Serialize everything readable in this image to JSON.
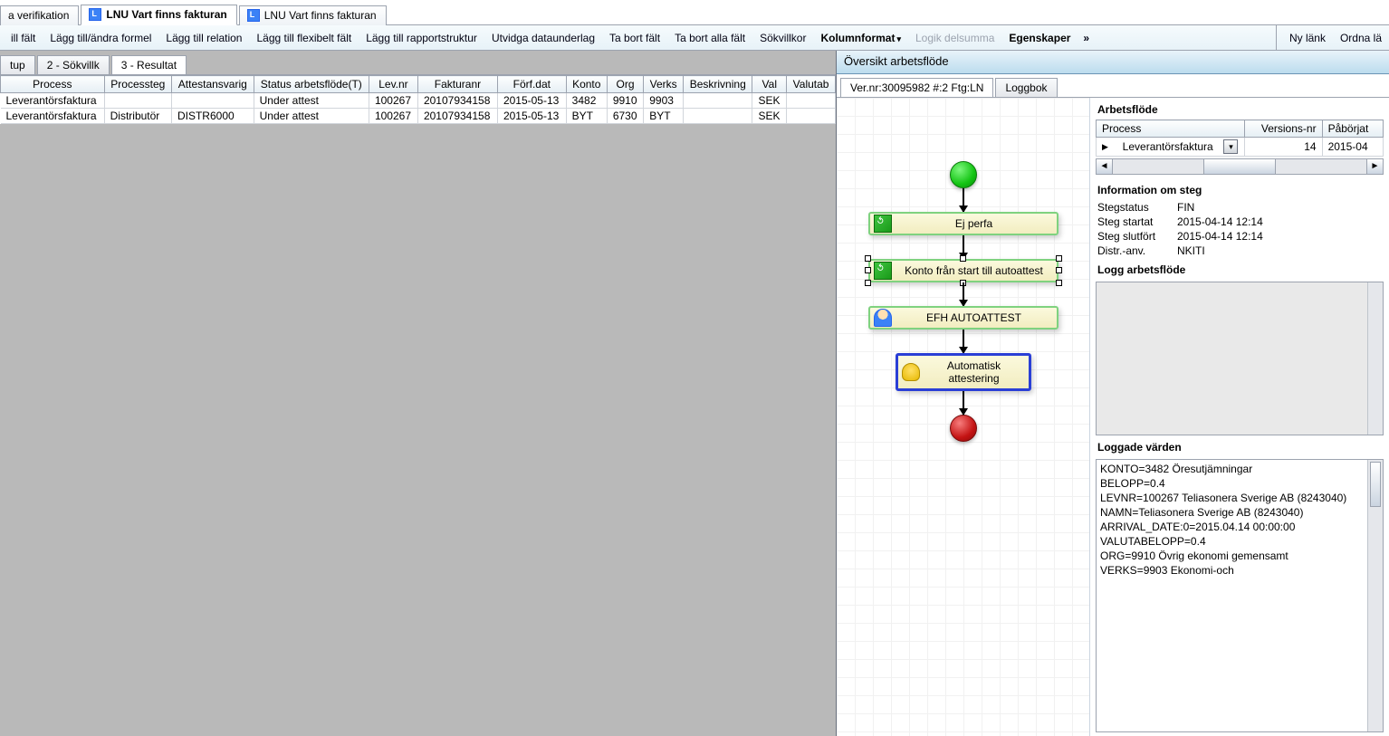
{
  "topTabs": [
    {
      "label": "a verifikation",
      "active": false,
      "hasIcon": false
    },
    {
      "label": "LNU Vart finns fakturan",
      "active": true,
      "hasIcon": true
    },
    {
      "label": "LNU Vart finns fakturan",
      "active": false,
      "hasIcon": true
    }
  ],
  "toolbar": {
    "left": [
      "ill fält",
      "Lägg till/ändra formel",
      "Lägg till relation",
      "Lägg till flexibelt fält",
      "Lägg till rapportstruktur",
      "Utvidga dataunderlag",
      "Ta bort fält",
      "Ta bort alla fält",
      "Sökvillkor"
    ],
    "kolumnformat": "Kolumnformat",
    "logik": "Logik delsumma",
    "egenskaper": "Egenskaper",
    "right": [
      "Ny länk",
      "Ordna lä"
    ]
  },
  "subTabs": [
    {
      "label": "tup",
      "active": false
    },
    {
      "label": "2 - Sökvillk",
      "active": false
    },
    {
      "label": "3 - Resultat",
      "active": true
    }
  ],
  "results": {
    "headers": [
      "Process",
      "Processteg",
      "Attestansvarig",
      "Status arbetsflöde(T)",
      "Lev.nr",
      "Fakturanr",
      "Förf.dat",
      "Konto",
      "Org",
      "Verks",
      "Beskrivning",
      "Val",
      "Valutab"
    ],
    "rows": [
      [
        "Leverantörsfaktura",
        "",
        "",
        "Under attest",
        "100267",
        "20107934158",
        "2015-05-13",
        "3482",
        "9910",
        "9903",
        "",
        "SEK",
        ""
      ],
      [
        "Leverantörsfaktura",
        "Distributör",
        "DISTR6000",
        "Under attest",
        "100267",
        "20107934158",
        "2015-05-13",
        "BYT",
        "6730",
        "BYT",
        "",
        "SEK",
        ""
      ]
    ]
  },
  "right": {
    "header": "Översikt arbetsflöde",
    "tabs": [
      {
        "label": "Ver.nr:30095982 #:2 Ftg:LN",
        "active": true
      },
      {
        "label": "Loggbok",
        "active": false
      }
    ]
  },
  "flow": {
    "n1": "Ej perfa",
    "n2": "Konto från start till autoattest",
    "n3": "EFH AUTOATTEST",
    "n4": "Automatisk attestering"
  },
  "info": {
    "arbetsflode": "Arbetsflöde",
    "cols": {
      "process": "Process",
      "version": "Versions-nr",
      "paborjat": "Påbörjat"
    },
    "row": {
      "process": "Leverantörsfaktura",
      "version": "14",
      "paborjat": "2015-04"
    },
    "steg_title": "Information om steg",
    "steg": [
      [
        "Stegstatus",
        "FIN"
      ],
      [
        "Steg startat",
        "2015-04-14 12:14"
      ],
      [
        "Steg slutfört",
        "2015-04-14 12:14"
      ],
      [
        "Distr.-anv.",
        "NKITI"
      ]
    ],
    "log_title": "Logg arbetsflöde",
    "logged_title": "Loggade värden",
    "logged_lines": [
      "KONTO=3482 Öresutjämningar",
      "BELOPP=0.4",
      "LEVNR=100267 Teliasonera Sverige AB (8243040)",
      "NAMN=Teliasonera Sverige AB (8243040)",
      "ARRIVAL_DATE:0=2015.04.14 00:00:00",
      "VALUTABELOPP=0.4",
      "ORG=9910 Övrig ekonomi gemensamt",
      "VERKS=9903 Ekonomi-och"
    ]
  }
}
